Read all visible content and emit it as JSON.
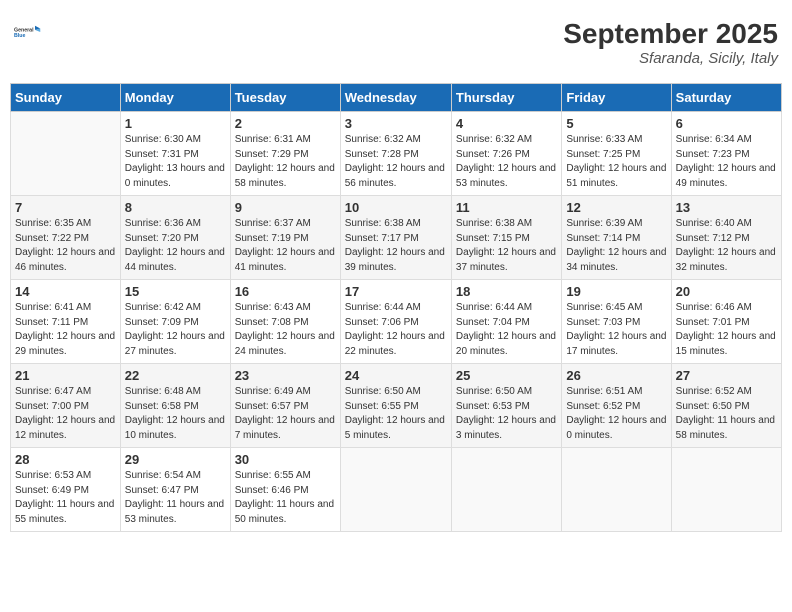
{
  "header": {
    "logo_line1": "General",
    "logo_line2": "Blue",
    "month": "September 2025",
    "location": "Sfaranda, Sicily, Italy"
  },
  "days_of_week": [
    "Sunday",
    "Monday",
    "Tuesday",
    "Wednesday",
    "Thursday",
    "Friday",
    "Saturday"
  ],
  "weeks": [
    [
      {
        "day": "",
        "empty": true
      },
      {
        "day": "1",
        "sunrise": "Sunrise: 6:30 AM",
        "sunset": "Sunset: 7:31 PM",
        "daylight": "Daylight: 13 hours and 0 minutes."
      },
      {
        "day": "2",
        "sunrise": "Sunrise: 6:31 AM",
        "sunset": "Sunset: 7:29 PM",
        "daylight": "Daylight: 12 hours and 58 minutes."
      },
      {
        "day": "3",
        "sunrise": "Sunrise: 6:32 AM",
        "sunset": "Sunset: 7:28 PM",
        "daylight": "Daylight: 12 hours and 56 minutes."
      },
      {
        "day": "4",
        "sunrise": "Sunrise: 6:32 AM",
        "sunset": "Sunset: 7:26 PM",
        "daylight": "Daylight: 12 hours and 53 minutes."
      },
      {
        "day": "5",
        "sunrise": "Sunrise: 6:33 AM",
        "sunset": "Sunset: 7:25 PM",
        "daylight": "Daylight: 12 hours and 51 minutes."
      },
      {
        "day": "6",
        "sunrise": "Sunrise: 6:34 AM",
        "sunset": "Sunset: 7:23 PM",
        "daylight": "Daylight: 12 hours and 49 minutes."
      }
    ],
    [
      {
        "day": "7",
        "sunrise": "Sunrise: 6:35 AM",
        "sunset": "Sunset: 7:22 PM",
        "daylight": "Daylight: 12 hours and 46 minutes."
      },
      {
        "day": "8",
        "sunrise": "Sunrise: 6:36 AM",
        "sunset": "Sunset: 7:20 PM",
        "daylight": "Daylight: 12 hours and 44 minutes."
      },
      {
        "day": "9",
        "sunrise": "Sunrise: 6:37 AM",
        "sunset": "Sunset: 7:19 PM",
        "daylight": "Daylight: 12 hours and 41 minutes."
      },
      {
        "day": "10",
        "sunrise": "Sunrise: 6:38 AM",
        "sunset": "Sunset: 7:17 PM",
        "daylight": "Daylight: 12 hours and 39 minutes."
      },
      {
        "day": "11",
        "sunrise": "Sunrise: 6:38 AM",
        "sunset": "Sunset: 7:15 PM",
        "daylight": "Daylight: 12 hours and 37 minutes."
      },
      {
        "day": "12",
        "sunrise": "Sunrise: 6:39 AM",
        "sunset": "Sunset: 7:14 PM",
        "daylight": "Daylight: 12 hours and 34 minutes."
      },
      {
        "day": "13",
        "sunrise": "Sunrise: 6:40 AM",
        "sunset": "Sunset: 7:12 PM",
        "daylight": "Daylight: 12 hours and 32 minutes."
      }
    ],
    [
      {
        "day": "14",
        "sunrise": "Sunrise: 6:41 AM",
        "sunset": "Sunset: 7:11 PM",
        "daylight": "Daylight: 12 hours and 29 minutes."
      },
      {
        "day": "15",
        "sunrise": "Sunrise: 6:42 AM",
        "sunset": "Sunset: 7:09 PM",
        "daylight": "Daylight: 12 hours and 27 minutes."
      },
      {
        "day": "16",
        "sunrise": "Sunrise: 6:43 AM",
        "sunset": "Sunset: 7:08 PM",
        "daylight": "Daylight: 12 hours and 24 minutes."
      },
      {
        "day": "17",
        "sunrise": "Sunrise: 6:44 AM",
        "sunset": "Sunset: 7:06 PM",
        "daylight": "Daylight: 12 hours and 22 minutes."
      },
      {
        "day": "18",
        "sunrise": "Sunrise: 6:44 AM",
        "sunset": "Sunset: 7:04 PM",
        "daylight": "Daylight: 12 hours and 20 minutes."
      },
      {
        "day": "19",
        "sunrise": "Sunrise: 6:45 AM",
        "sunset": "Sunset: 7:03 PM",
        "daylight": "Daylight: 12 hours and 17 minutes."
      },
      {
        "day": "20",
        "sunrise": "Sunrise: 6:46 AM",
        "sunset": "Sunset: 7:01 PM",
        "daylight": "Daylight: 12 hours and 15 minutes."
      }
    ],
    [
      {
        "day": "21",
        "sunrise": "Sunrise: 6:47 AM",
        "sunset": "Sunset: 7:00 PM",
        "daylight": "Daylight: 12 hours and 12 minutes."
      },
      {
        "day": "22",
        "sunrise": "Sunrise: 6:48 AM",
        "sunset": "Sunset: 6:58 PM",
        "daylight": "Daylight: 12 hours and 10 minutes."
      },
      {
        "day": "23",
        "sunrise": "Sunrise: 6:49 AM",
        "sunset": "Sunset: 6:57 PM",
        "daylight": "Daylight: 12 hours and 7 minutes."
      },
      {
        "day": "24",
        "sunrise": "Sunrise: 6:50 AM",
        "sunset": "Sunset: 6:55 PM",
        "daylight": "Daylight: 12 hours and 5 minutes."
      },
      {
        "day": "25",
        "sunrise": "Sunrise: 6:50 AM",
        "sunset": "Sunset: 6:53 PM",
        "daylight": "Daylight: 12 hours and 3 minutes."
      },
      {
        "day": "26",
        "sunrise": "Sunrise: 6:51 AM",
        "sunset": "Sunset: 6:52 PM",
        "daylight": "Daylight: 12 hours and 0 minutes."
      },
      {
        "day": "27",
        "sunrise": "Sunrise: 6:52 AM",
        "sunset": "Sunset: 6:50 PM",
        "daylight": "Daylight: 11 hours and 58 minutes."
      }
    ],
    [
      {
        "day": "28",
        "sunrise": "Sunrise: 6:53 AM",
        "sunset": "Sunset: 6:49 PM",
        "daylight": "Daylight: 11 hours and 55 minutes."
      },
      {
        "day": "29",
        "sunrise": "Sunrise: 6:54 AM",
        "sunset": "Sunset: 6:47 PM",
        "daylight": "Daylight: 11 hours and 53 minutes."
      },
      {
        "day": "30",
        "sunrise": "Sunrise: 6:55 AM",
        "sunset": "Sunset: 6:46 PM",
        "daylight": "Daylight: 11 hours and 50 minutes."
      },
      {
        "day": "",
        "empty": true
      },
      {
        "day": "",
        "empty": true
      },
      {
        "day": "",
        "empty": true
      },
      {
        "day": "",
        "empty": true
      }
    ]
  ]
}
